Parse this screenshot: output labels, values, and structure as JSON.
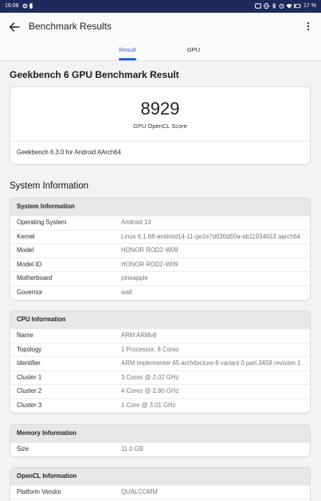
{
  "status_bar": {
    "time": "16:08",
    "battery_text": "17 %",
    "left_icons": [
      "gear-icon",
      "sim-card-icon"
    ],
    "right_icons": [
      "nfc-icon",
      "vibrate-icon",
      "bluetooth-icon",
      "alarm-icon",
      "wifi-icon",
      "battery-icon"
    ]
  },
  "app_bar": {
    "title": "Benchmark Results",
    "back_icon": "arrow-back-icon",
    "menu_icon": "more-vertical-icon"
  },
  "tabs": [
    {
      "label": "Result",
      "active": true
    },
    {
      "label": "GPU",
      "active": false
    }
  ],
  "result": {
    "heading": "Geekbench 6 GPU Benchmark Result",
    "score": "8929",
    "score_label": "GPU OpenCL Score",
    "version": "Geekbench 6.3.0 for Android AArch64"
  },
  "system_information": {
    "heading": "System Information",
    "sections": [
      {
        "title": "System Information",
        "rows": [
          {
            "label": "Operating System",
            "value": "Android 14"
          },
          {
            "label": "Kernel",
            "value": "Linux 6.1.68-android14-11-ge1e7d630d60a-ab11934653 aarch64"
          },
          {
            "label": "Model",
            "value": "HONOR ROD2-W09"
          },
          {
            "label": "Model ID",
            "value": "HONOR ROD2-W09"
          },
          {
            "label": "Motherboard",
            "value": "pineapple"
          },
          {
            "label": "Governor",
            "value": "walt"
          }
        ]
      },
      {
        "title": "CPU Information",
        "rows": [
          {
            "label": "Name",
            "value": "ARM ARMv8"
          },
          {
            "label": "Topology",
            "value": "1 Processor, 8 Cores"
          },
          {
            "label": "Identifier",
            "value": "ARM implementer 65 architecture 8 variant 0 part 3458 revision 1"
          },
          {
            "label": "Cluster 1",
            "value": "3 Cores @ 2.02 GHz"
          },
          {
            "label": "Cluster 2",
            "value": "4 Cores @ 2.80 GHz"
          },
          {
            "label": "Cluster 3",
            "value": "1 Core @ 3.01 GHz"
          }
        ]
      },
      {
        "title": "Memory Information",
        "rows": [
          {
            "label": "Size",
            "value": "11.0 GB"
          }
        ]
      },
      {
        "title": "OpenCL Information",
        "rows": [
          {
            "label": "Platform Vendor",
            "value": "QUALCOMM"
          }
        ]
      }
    ]
  },
  "colors": {
    "status_bar": "#1e2a5c",
    "accent": "#2a62d8",
    "background": "#f3f3f3",
    "card_header": "#e7e7e7",
    "value_text": "#777777"
  }
}
